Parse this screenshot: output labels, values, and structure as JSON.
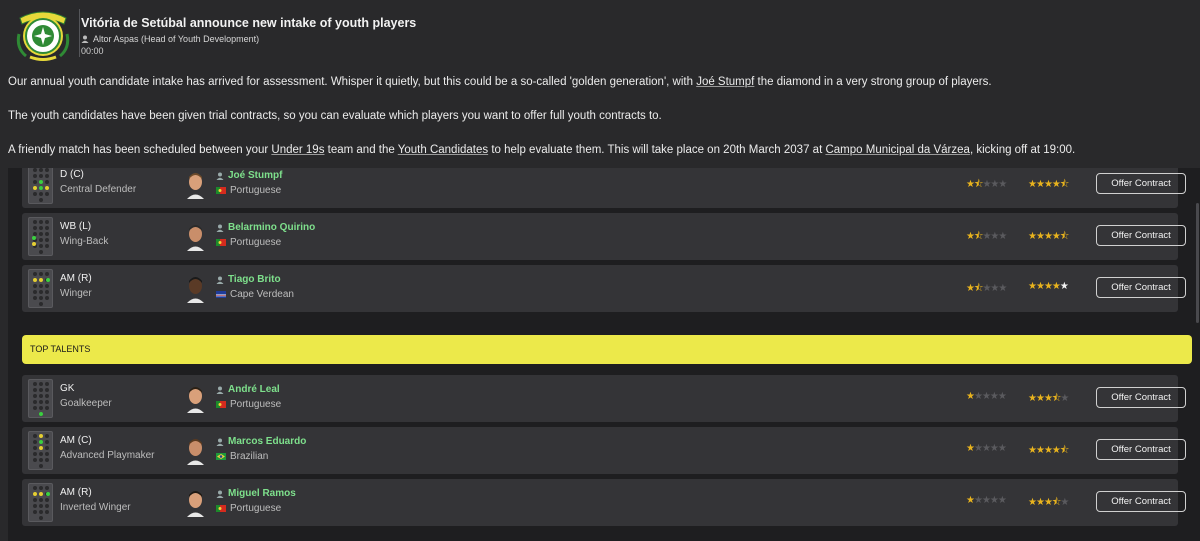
{
  "header": {
    "title": "Vitória de Setúbal announce new intake of youth players",
    "author": "Altor Aspas  (Head of Youth Development)",
    "time": "00:00"
  },
  "paragraphs": {
    "p1": "Our annual youth candidate intake has arrived for assessment. Whisper it quietly, but this could be a so-called 'golden generation', with ",
    "p1_link": "Joé Stumpf",
    "p1_end": " the diamond in a very strong group of players.",
    "p2": "The youth candidates have been given trial contracts, so you can evaluate which players you want to offer full youth contracts to.",
    "p3a": "A friendly match has been scheduled between your ",
    "p3_link1": "Under 19s",
    "p3b": " team and the ",
    "p3_link2": "Youth Candidates",
    "p3c": " to help evaluate them. This will take place on 20th March 2037 at ",
    "p3_link3": "Campo Municipal da Várzea",
    "p3d": ", kicking off at 19:00."
  },
  "section_label": "TOP TALENTS",
  "offer_label": "Offer Contract",
  "players_upper": [
    {
      "pos": "D (C)",
      "role": "Central Defender",
      "name": "Joé Stumpf",
      "nationality": "Portuguese",
      "current_ability": 1.5,
      "potential_ability": 4.5
    },
    {
      "pos": "WB (L)",
      "role": "Wing-Back",
      "name": "Belarmino Quirino",
      "nationality": "Portuguese",
      "current_ability": 1.5,
      "potential_ability": 4.5
    },
    {
      "pos": "AM (R)",
      "role": "Winger",
      "name": "Tiago Brito",
      "nationality": "Cape Verdean",
      "current_ability": 1.5,
      "potential_ability": 5
    }
  ],
  "players_lower": [
    {
      "pos": "GK",
      "role": "Goalkeeper",
      "name": "André Leal",
      "nationality": "Portuguese",
      "current_ability": 1,
      "potential_ability": 3.5
    },
    {
      "pos": "AM (C)",
      "role": "Advanced Playmaker",
      "name": "Marcos Eduardo",
      "nationality": "Brazilian",
      "current_ability": 1,
      "potential_ability": 4.5
    },
    {
      "pos": "AM (R)",
      "role": "Inverted Winger",
      "name": "Miguel Ramos",
      "nationality": "Portuguese",
      "current_ability": 1,
      "potential_ability": 3.5
    }
  ],
  "colors": {
    "background": "#29292b",
    "list_bg": "#1e1e20",
    "row_bg": "#343437",
    "section_yellow": "#ece94a",
    "name_green": "#7ee08c",
    "star_gold": "#e8b31e"
  }
}
